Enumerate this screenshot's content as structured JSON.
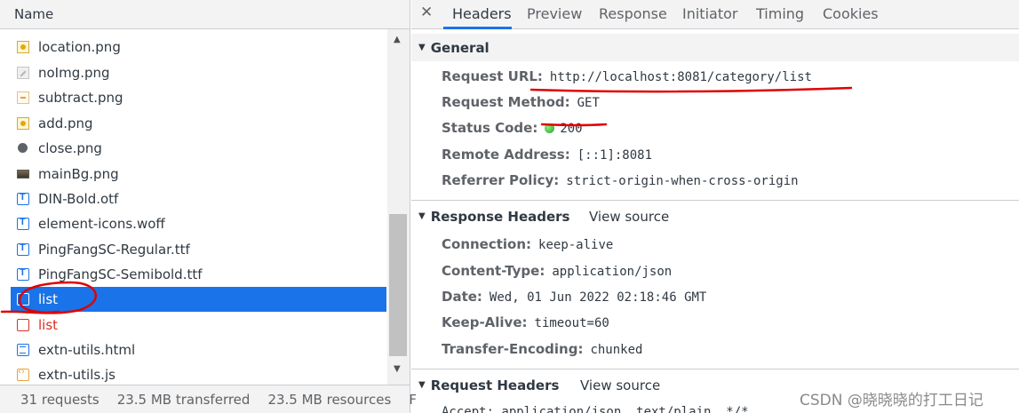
{
  "left": {
    "header": "Name",
    "rows": [
      {
        "name": "location.png",
        "icon": "image-file-icon"
      },
      {
        "name": "noImg.png",
        "icon": "image-file-icon"
      },
      {
        "name": "subtract.png",
        "icon": "image-file-icon"
      },
      {
        "name": "add.png",
        "icon": "image-file-icon"
      },
      {
        "name": "close.png",
        "icon": "image-file-icon"
      },
      {
        "name": "mainBg.png",
        "icon": "image-file-icon"
      },
      {
        "name": "DIN-Bold.otf",
        "icon": "font-file-icon"
      },
      {
        "name": "element-icons.woff",
        "icon": "font-file-icon"
      },
      {
        "name": "PingFangSC-Regular.ttf",
        "icon": "font-file-icon"
      },
      {
        "name": "PingFangSC-Semibold.ttf",
        "icon": "font-file-icon"
      },
      {
        "name": "list",
        "icon": "document-icon",
        "state": "selected"
      },
      {
        "name": "list",
        "icon": "document-icon",
        "state": "error"
      },
      {
        "name": "extn-utils.html",
        "icon": "html-file-icon"
      },
      {
        "name": "extn-utils.js",
        "icon": "script-file-icon"
      }
    ],
    "status": {
      "requests": "31 requests",
      "transferred": "23.5 MB transferred",
      "resources": "23.5 MB resources",
      "extra": "F"
    }
  },
  "right": {
    "close": "✕",
    "tabs": [
      "Headers",
      "Preview",
      "Response",
      "Initiator",
      "Timing",
      "Cookies"
    ],
    "active_tab": "Headers",
    "general": {
      "title": "General",
      "rows": [
        {
          "key": "Request URL:",
          "value": "http://localhost:8081/category/list"
        },
        {
          "key": "Request Method:",
          "value": "GET"
        },
        {
          "key": "Status Code:",
          "value": "200"
        },
        {
          "key": "Remote Address:",
          "value": "[::1]:8081"
        },
        {
          "key": "Referrer Policy:",
          "value": "strict-origin-when-cross-origin"
        }
      ]
    },
    "response_headers": {
      "title": "Response Headers",
      "view_source": "View source",
      "rows": [
        {
          "key": "Connection:",
          "value": "keep-alive"
        },
        {
          "key": "Content-Type:",
          "value": "application/json"
        },
        {
          "key": "Date:",
          "value": "Wed, 01 Jun 2022 02:18:46 GMT"
        },
        {
          "key": "Keep-Alive:",
          "value": "timeout=60"
        },
        {
          "key": "Transfer-Encoding:",
          "value": "chunked"
        }
      ]
    },
    "request_headers": {
      "title": "Request Headers",
      "view_source": "View source",
      "partial_row": "Accept: application/json, text/plain, */*"
    }
  },
  "watermark": "CSDN @晓晓晓的打工日记",
  "colors": {
    "selected_row": "#1a73e8",
    "error_text": "#d93025",
    "annotation": "#e00000"
  }
}
